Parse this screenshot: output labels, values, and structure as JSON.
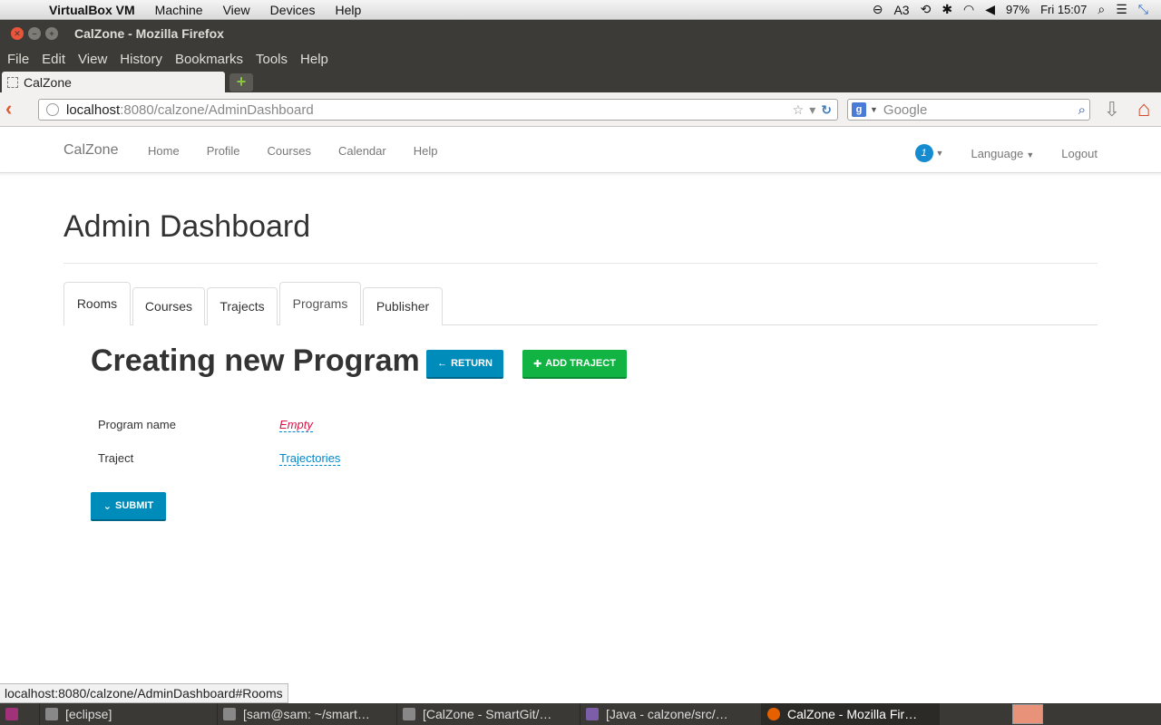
{
  "macbar": {
    "app_name": "VirtualBox VM",
    "menus": [
      "Machine",
      "View",
      "Devices",
      "Help"
    ],
    "keyboard": "3",
    "battery": "97%",
    "clock": "Fri 15:07"
  },
  "window": {
    "title": "CalZone - Mozilla Firefox"
  },
  "firefox_menu": [
    "File",
    "Edit",
    "View",
    "History",
    "Bookmarks",
    "Tools",
    "Help"
  ],
  "tab": {
    "label": "CalZone"
  },
  "url": {
    "host": "localhost",
    "rest": ":8080/calzone/AdminDashboard"
  },
  "search": {
    "placeholder": "Google"
  },
  "appnav": {
    "brand": "CalZone",
    "links": [
      "Home",
      "Profile",
      "Courses",
      "Calendar",
      "Help"
    ],
    "badge": "1",
    "language": "Language",
    "logout": "Logout"
  },
  "page_title": "Admin Dashboard",
  "tabs": [
    "Rooms",
    "Courses",
    "Trajects",
    "Programs",
    "Publisher"
  ],
  "selected_tab": "Programs",
  "section_title": "Creating new Program",
  "buttons": {
    "return": "RETURN",
    "add_traject": "ADD TRAJECT",
    "submit": "SUBMIT"
  },
  "fields": {
    "program_name_label": "Program name",
    "program_name_value": "Empty",
    "traject_label": "Traject",
    "traject_value": "Trajectories"
  },
  "status_url": "localhost:8080/calzone/AdminDashboard#Rooms",
  "taskbar": [
    "[eclipse]",
    "[sam@sam: ~/smart…",
    "[CalZone - SmartGit/…",
    "[Java - calzone/src/…",
    "CalZone - Mozilla Fir…"
  ]
}
